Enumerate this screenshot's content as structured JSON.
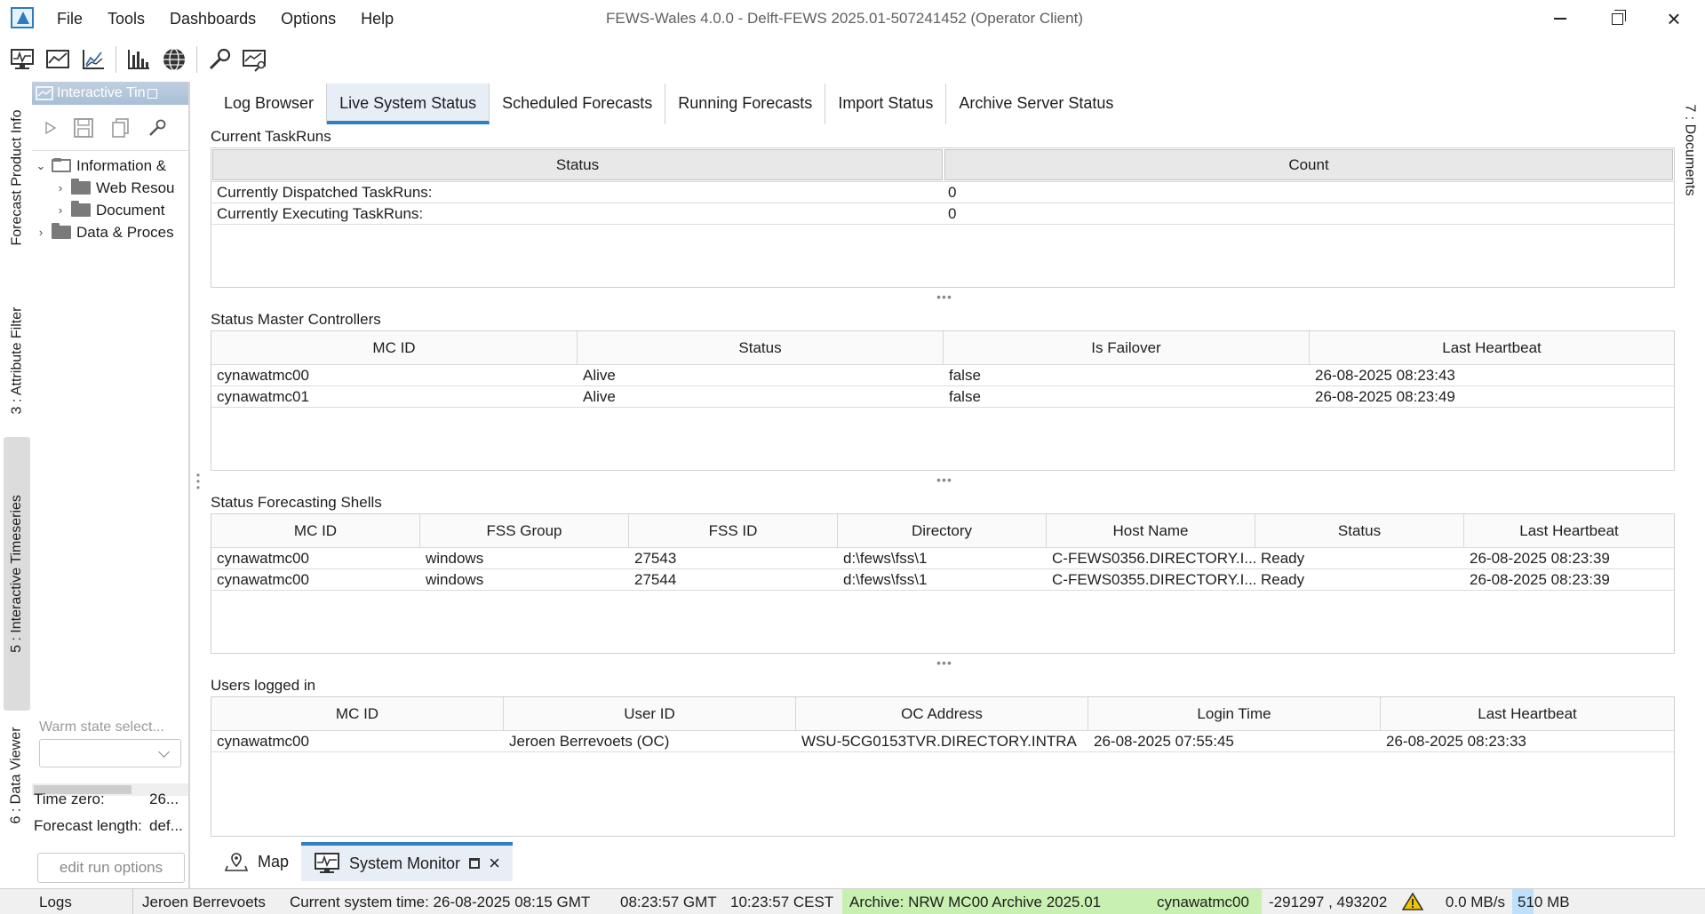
{
  "app": {
    "window_title": "FEWS-Wales 4.0.0 - Delft-FEWS 2025.01-507241452  (Operator Client)",
    "menu": [
      "File",
      "Tools",
      "Dashboards",
      "Options",
      "Help"
    ]
  },
  "toolbar_icons": [
    "system-monitor-icon",
    "chart-icon",
    "graph-icon",
    "column-chart-icon",
    "globe-icon",
    "wrench-icon",
    "graph-wrench-icon"
  ],
  "left_vertical_tabs": [
    {
      "label": "Forecast Product Info",
      "active": false
    },
    {
      "label": "3 : Attribute Filter",
      "active": false
    },
    {
      "label": "5 : Interactive Timeseries",
      "active": true
    },
    {
      "label": "6 : Data Viewer",
      "active": false
    }
  ],
  "left_panel": {
    "title": "Interactive Tin",
    "tree": [
      {
        "label": "Information &",
        "depth": 0,
        "expanded": true
      },
      {
        "label": "Web Resou",
        "depth": 1,
        "expanded": false
      },
      {
        "label": "Document",
        "depth": 1,
        "expanded": false
      },
      {
        "label": "Data & Proces",
        "depth": 0,
        "expanded": false
      }
    ],
    "warm_state_placeholder": "Warm state select...",
    "time_zero_label": "Time zero:",
    "time_zero_value": "26...",
    "forecast_length_label": "Forecast length:",
    "forecast_length_value": "def...",
    "edit_run_button": "edit run options"
  },
  "main_tabs": [
    {
      "label": "Log Browser",
      "active": false
    },
    {
      "label": "Live System Status",
      "active": true
    },
    {
      "label": "Scheduled Forecasts",
      "active": false
    },
    {
      "label": "Running Forecasts",
      "active": false
    },
    {
      "label": "Import Status",
      "active": false
    },
    {
      "label": "Archive Server Status",
      "active": false
    }
  ],
  "sections": {
    "current_taskruns": {
      "title": "Current TaskRuns",
      "columns": [
        "Status",
        "Count"
      ],
      "rows": [
        [
          "Currently Dispatched TaskRuns:",
          "0"
        ],
        [
          "Currently Executing TaskRuns:",
          "0"
        ]
      ]
    },
    "master_controllers": {
      "title": "Status Master Controllers",
      "columns": [
        "MC ID",
        "Status",
        "Is Failover",
        "Last Heartbeat"
      ],
      "rows": [
        [
          "cynawatmc00",
          "Alive",
          "false",
          "26-08-2025 08:23:43"
        ],
        [
          "cynawatmc01",
          "Alive",
          "false",
          "26-08-2025 08:23:49"
        ]
      ]
    },
    "forecasting_shells": {
      "title": "Status Forecasting Shells",
      "columns": [
        "MC ID",
        "FSS Group",
        "FSS ID",
        "Directory",
        "Host Name",
        "Status",
        "Last Heartbeat"
      ],
      "rows": [
        [
          "cynawatmc00",
          "windows",
          "27543",
          "d:\\fews\\fss\\1",
          "C-FEWS0356.DIRECTORY.I...",
          "Ready",
          "26-08-2025 08:23:39"
        ],
        [
          "cynawatmc00",
          "windows",
          "27544",
          "d:\\fews\\fss\\1",
          "C-FEWS0355.DIRECTORY.I...",
          "Ready",
          "26-08-2025 08:23:39"
        ]
      ]
    },
    "users_logged_in": {
      "title": "Users logged in",
      "columns": [
        "MC ID",
        "User ID",
        "OC Address",
        "Login Time",
        "Last Heartbeat"
      ],
      "rows": [
        [
          "cynawatmc00",
          "Jeroen Berrevoets (OC)",
          "WSU-5CG0153TVR.DIRECTORY.INTRA",
          "26-08-2025 07:55:45",
          "26-08-2025 08:23:33"
        ]
      ]
    }
  },
  "right_vertical_tab": "7 : Documents",
  "bottom_tabs": [
    {
      "label": "Map",
      "icon": "map-pin-icon",
      "active": false
    },
    {
      "label": "System Monitor",
      "icon": "system-monitor-icon",
      "active": true
    }
  ],
  "status_bar": {
    "logs": "Logs",
    "user": "Jeroen Berrevoets",
    "system_time": "Current system time: 26-08-2025 08:15 GMT",
    "gmt_time": "08:23:57 GMT",
    "cest_time": "10:23:57 CEST",
    "archive": "Archive: NRW MC00 Archive 2025.01",
    "mc": "cynawatmc00",
    "coords": "-291297 , 493202",
    "rate": "0.0 MB/s",
    "memory": "510 MB"
  },
  "colors": {
    "accent": "#2f7fc2",
    "archive_bg": "#c8f0b0",
    "memory_bg": "#bfe0fb",
    "warning": "#f2c400"
  }
}
